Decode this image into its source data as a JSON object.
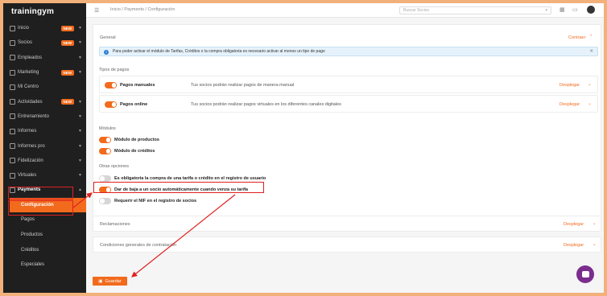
{
  "app": {
    "logo": "trainingym"
  },
  "sidebar": {
    "items": [
      {
        "label": "Inicio",
        "badge": "NEW",
        "icon": "home-icon"
      },
      {
        "label": "Socios",
        "badge": "NEW",
        "icon": "users-icon"
      },
      {
        "label": "Empleados",
        "badge": "",
        "icon": "briefcase-icon"
      },
      {
        "label": "Marketing",
        "badge": "NEW",
        "icon": "megaphone-icon"
      },
      {
        "label": "Mi Centro",
        "badge": "",
        "icon": "location-icon"
      },
      {
        "label": "Actividades",
        "badge": "NEW",
        "icon": "calendar-icon"
      },
      {
        "label": "Entrenamiento",
        "badge": "",
        "icon": "dumbbell-icon"
      },
      {
        "label": "Informes",
        "badge": "",
        "icon": "chart-icon"
      },
      {
        "label": "Informes pro",
        "badge": "",
        "icon": "chart-pro-icon"
      },
      {
        "label": "Fidelización",
        "badge": "",
        "icon": "heart-icon"
      },
      {
        "label": "Virtuales",
        "badge": "",
        "icon": "video-icon"
      },
      {
        "label": "Payments",
        "badge": "",
        "icon": "payments-icon"
      }
    ],
    "payments_sub": [
      "Configuración",
      "Pagos",
      "Productos",
      "Créditos",
      "Especiales"
    ]
  },
  "topbar": {
    "breadcrumb": "Inicio  /  Payments  /  Configuración",
    "search_placeholder": "Buscar Socios"
  },
  "general": {
    "title": "General",
    "toggle_link": "Contraer",
    "info": "Para poder activar el módulo de Tarifas, Créditos o la compra obligatoria es necesario activar al menos un tipo de pago"
  },
  "payment_types": {
    "title": "Tipos de pagos",
    "rows": [
      {
        "label": "Pagos manuales",
        "desc": "Tus socios podrán realizar pagos de manera manual",
        "action": "Desplegar",
        "on": true
      },
      {
        "label": "Pagos online",
        "desc": "Tus socios podrán realizar pagos virtuales en los diferentes canales digitales",
        "action": "Desplegar",
        "on": true
      }
    ]
  },
  "modules": {
    "title": "Módulos",
    "items": [
      {
        "label": "Módulo de productos",
        "on": true
      },
      {
        "label": "Módulo de créditos",
        "on": true
      }
    ]
  },
  "other": {
    "title": "Otras opciones",
    "items": [
      {
        "label": "Es obligatoria la compra de una tarifa o crédito en el registro de usuario",
        "on": false
      },
      {
        "label": "Dar de baja a un socio automáticamente cuando venza su tarifa",
        "on": true
      },
      {
        "label": "Requerir el NIF en el registro de socios",
        "on": false
      }
    ]
  },
  "reclamaciones": {
    "title": "Reclamaciones",
    "action": "Desplegar"
  },
  "conditions": {
    "title": "Condiciones generales de contratación",
    "action": "Desplegar"
  },
  "save_label": "Guardar",
  "colors": {
    "accent": "#f26b1d",
    "annotation": "#e02020",
    "sidebar": "#1f1f1f",
    "chat": "#7b2d8e"
  }
}
